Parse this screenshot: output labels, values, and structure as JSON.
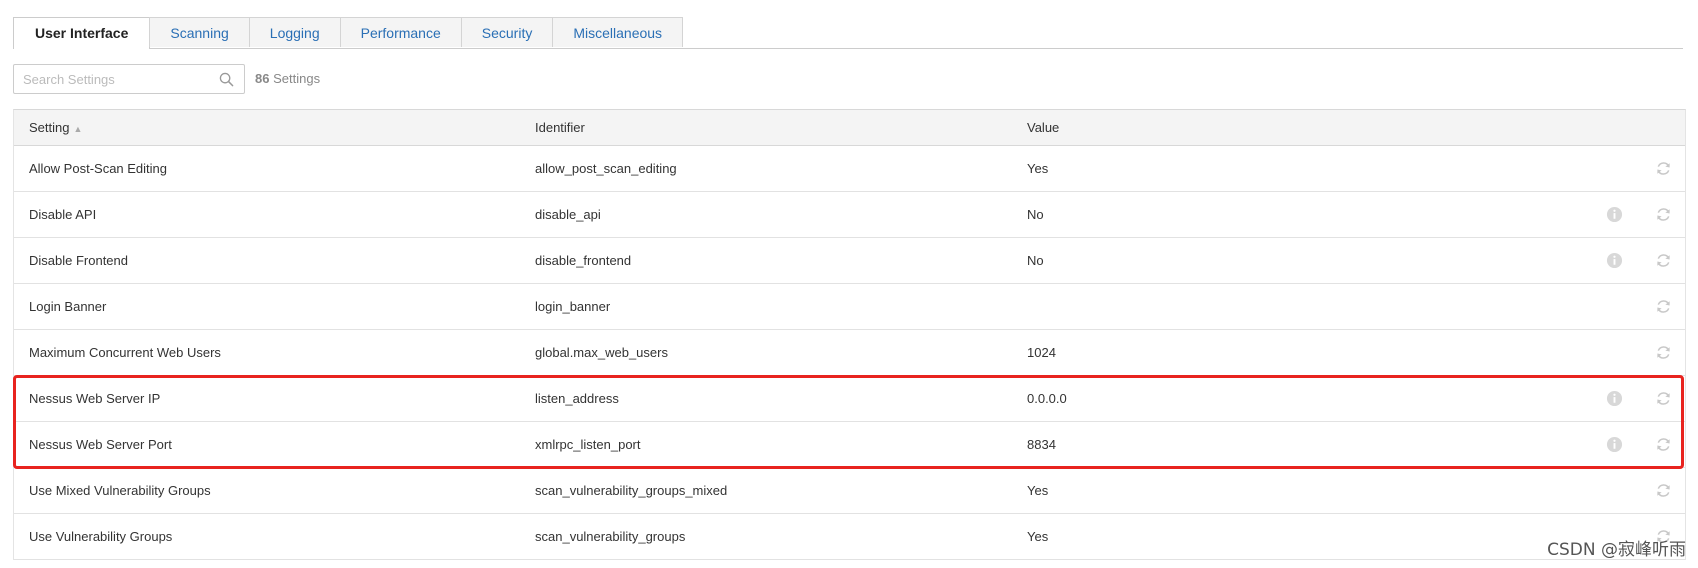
{
  "tabs": [
    {
      "label": "User Interface",
      "active": true
    },
    {
      "label": "Scanning",
      "active": false
    },
    {
      "label": "Logging",
      "active": false
    },
    {
      "label": "Performance",
      "active": false
    },
    {
      "label": "Security",
      "active": false
    },
    {
      "label": "Miscellaneous",
      "active": false
    }
  ],
  "search": {
    "placeholder": "Search Settings",
    "value": ""
  },
  "settings_count": {
    "number": "86",
    "label": "Settings"
  },
  "table": {
    "columns": {
      "setting": "Setting",
      "identifier": "Identifier",
      "value": "Value"
    },
    "sort_indicator": "▲",
    "rows": [
      {
        "setting": "Allow Post-Scan Editing",
        "identifier": "allow_post_scan_editing",
        "value": "Yes",
        "info": false
      },
      {
        "setting": "Disable API",
        "identifier": "disable_api",
        "value": "No",
        "info": true
      },
      {
        "setting": "Disable Frontend",
        "identifier": "disable_frontend",
        "value": "No",
        "info": true
      },
      {
        "setting": "Login Banner",
        "identifier": "login_banner",
        "value": "",
        "info": false
      },
      {
        "setting": "Maximum Concurrent Web Users",
        "identifier": "global.max_web_users",
        "value": "1024",
        "info": false
      },
      {
        "setting": "Nessus Web Server IP",
        "identifier": "listen_address",
        "value": "0.0.0.0",
        "info": true
      },
      {
        "setting": "Nessus Web Server Port",
        "identifier": "xmlrpc_listen_port",
        "value": "8834",
        "info": true
      },
      {
        "setting": "Use Mixed Vulnerability Groups",
        "identifier": "scan_vulnerability_groups_mixed",
        "value": "Yes",
        "info": false
      },
      {
        "setting": "Use Vulnerability Groups",
        "identifier": "scan_vulnerability_groups",
        "value": "Yes",
        "info": false
      }
    ]
  },
  "watermark": "CSDN @寂峰听雨",
  "colors": {
    "accent": "#2a6fb5",
    "highlight": "#e8231f",
    "icon": "#c8c8c8"
  },
  "icons": {
    "search": "search-icon",
    "info": "info-icon",
    "reset": "reset-icon"
  }
}
